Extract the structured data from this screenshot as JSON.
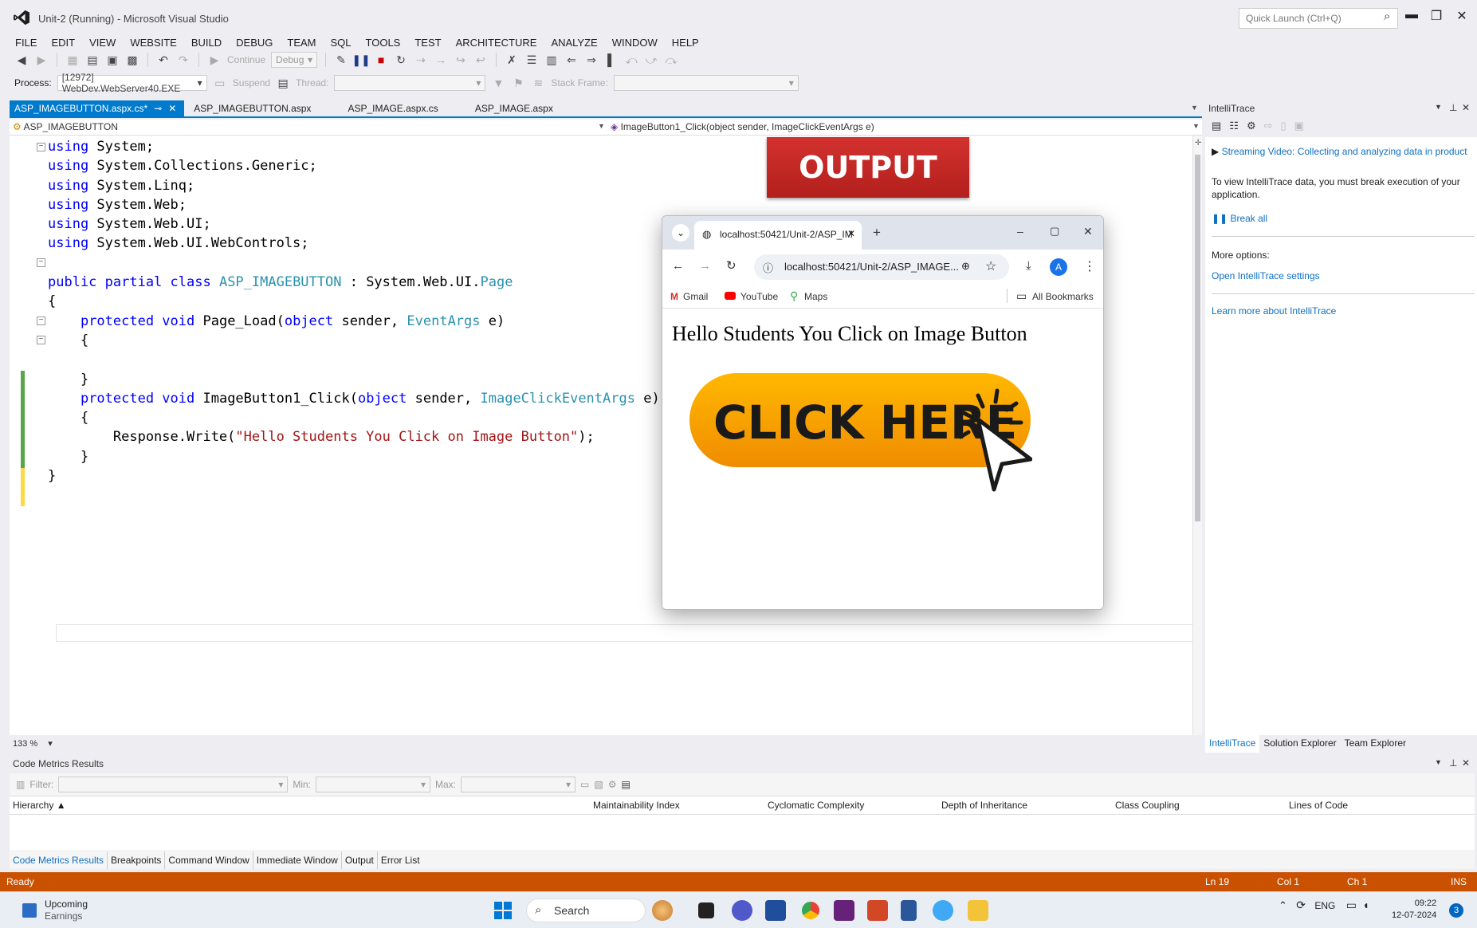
{
  "window": {
    "title": "Unit-2 (Running) - Microsoft Visual Studio",
    "quick_launch_placeholder": "Quick Launch (Ctrl+Q)"
  },
  "menu": [
    "FILE",
    "EDIT",
    "VIEW",
    "WEBSITE",
    "BUILD",
    "DEBUG",
    "TEAM",
    "SQL",
    "TOOLS",
    "TEST",
    "ARCHITECTURE",
    "ANALYZE",
    "WINDOW",
    "HELP"
  ],
  "toolbar": {
    "continue_label": "Continue",
    "config_value": "Debug",
    "process_label": "Process:",
    "process_value": "[12972] WebDev.WebServer40.EXE",
    "suspend_label": "Suspend",
    "thread_label": "Thread:",
    "stack_frame_label": "Stack Frame:"
  },
  "tabs": [
    {
      "label": "ASP_IMAGEBUTTON.aspx.cs*",
      "active": true
    },
    {
      "label": "ASP_IMAGEBUTTON.aspx",
      "active": false
    },
    {
      "label": "ASP_IMAGE.aspx.cs",
      "active": false
    },
    {
      "label": "ASP_IMAGE.aspx",
      "active": false
    }
  ],
  "navbar": {
    "class_value": "ASP_IMAGEBUTTON",
    "member_value": "ImageButton1_Click(object sender, ImageClickEventArgs e)"
  },
  "editor": {
    "zoom": "133 %"
  },
  "overlay": {
    "banner": "OUTPUT"
  },
  "browser": {
    "tab_title": "localhost:50421/Unit-2/ASP_IM",
    "url": "localhost:50421/Unit-2/ASP_IMAGE...",
    "profile_initial": "A",
    "bookmarks": [
      "Gmail",
      "YouTube",
      "Maps"
    ],
    "all_bookmarks": "All Bookmarks",
    "page_text": "Hello Students You Click on Image Button",
    "button_text": "CLICK HERE"
  },
  "intellitrace": {
    "title": "IntelliTrace",
    "streaming_link": "Streaming Video: Collecting and analyzing data in product",
    "info": "To view IntelliTrace data, you must break execution of your application.",
    "break_all": "Break all",
    "more_options": "More options:",
    "open_settings": "Open IntelliTrace settings",
    "learn_more": "Learn more about IntelliTrace",
    "tabs": [
      "IntelliTrace",
      "Solution Explorer",
      "Team Explorer"
    ]
  },
  "code_metrics": {
    "title": "Code Metrics Results",
    "filter_label": "Filter:",
    "min_label": "Min:",
    "max_label": "Max:",
    "columns": [
      "Hierarchy",
      "Maintainability Index",
      "Cyclomatic Complexity",
      "Depth of Inheritance",
      "Class Coupling",
      "Lines of Code"
    ],
    "tabs": [
      "Code Metrics Results",
      "Breakpoints",
      "Command Window",
      "Immediate Window",
      "Output",
      "Error List"
    ]
  },
  "status": {
    "ready": "Ready",
    "ln": "Ln 19",
    "col": "Col 1",
    "ch": "Ch 1",
    "mode": "INS"
  },
  "taskbar": {
    "weather_title": "Upcoming",
    "weather_sub": "Earnings",
    "search": "Search",
    "lang": "ENG",
    "time": "09:22",
    "date": "12-07-2024",
    "notif_count": "3"
  },
  "colors": {
    "accent": "#007acc",
    "status_bar": "#ca5100",
    "banner": "#c62828",
    "click_button": "#f5a800"
  }
}
